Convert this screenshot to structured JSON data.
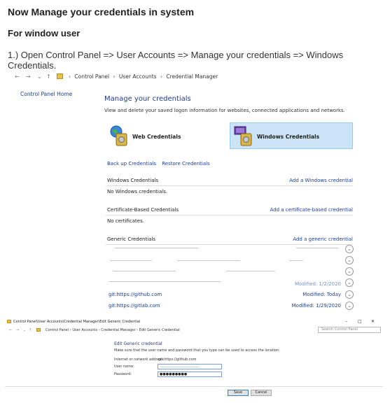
{
  "heading": "Now Manage your credentials in system",
  "subheading": "For window user",
  "step": "1.) Open Control Panel => User Accounts => Manage your credentials => Windows Credentials.",
  "shot1": {
    "nav": {
      "back": "←",
      "forward": "→",
      "down": "⌄",
      "up": "↑"
    },
    "breadcrumb": [
      "Control Panel",
      "User Accounts",
      "Credential Manager"
    ],
    "breadcrumb_sep": "›",
    "sidebar_home": "Control Panel Home",
    "title": "Manage your credentials",
    "description": "View and delete your saved logon information for websites, connected applications and networks.",
    "tiles": {
      "web": "Web Credentials",
      "windows": "Windows Credentials"
    },
    "links": {
      "backup": "Back up Credentials",
      "restore": "Restore Credentials"
    },
    "sections": {
      "windows": {
        "name": "Windows Credentials",
        "add": "Add a Windows credential",
        "empty": "No Windows credentials."
      },
      "certificate": {
        "name": "Certificate-Based Credentials",
        "add": "Add a certificate-based credential",
        "empty": "No certificates."
      },
      "generic": {
        "name": "Generic Credentials",
        "add": "Add a generic credential"
      }
    },
    "credentials": [
      {
        "name": "git:https://github.com",
        "modified": "Modified:  Today"
      },
      {
        "name": "git:https://gitlab.com",
        "modified": "Modified:  1/29/2020"
      }
    ],
    "partial_modified": "Modified:  1/2/2020",
    "chevron": "⌄"
  },
  "shot2": {
    "window_title": "Control Panel\\User Accounts\\Credential Manager\\Edit Generic Credential",
    "window_controls": {
      "min": "–",
      "max": "□",
      "close": "✕"
    },
    "breadcrumb": "Control Panel  ›  User Accounts  ›  Credential Manager  ›  Edit Generic Credential",
    "search_placeholder": "Search Control Panel",
    "title": "Edit Generic credential",
    "description": "Make sure that the user name and password that you type can be used to access the location.",
    "fields": {
      "address_label": "Internet or network address:",
      "address_value": "git:https://github.com",
      "username_label": "User name:",
      "password_label": "Password:",
      "password_value": "●●●●●●●●●"
    },
    "buttons": {
      "save": "Save",
      "cancel": "Cancel"
    }
  }
}
